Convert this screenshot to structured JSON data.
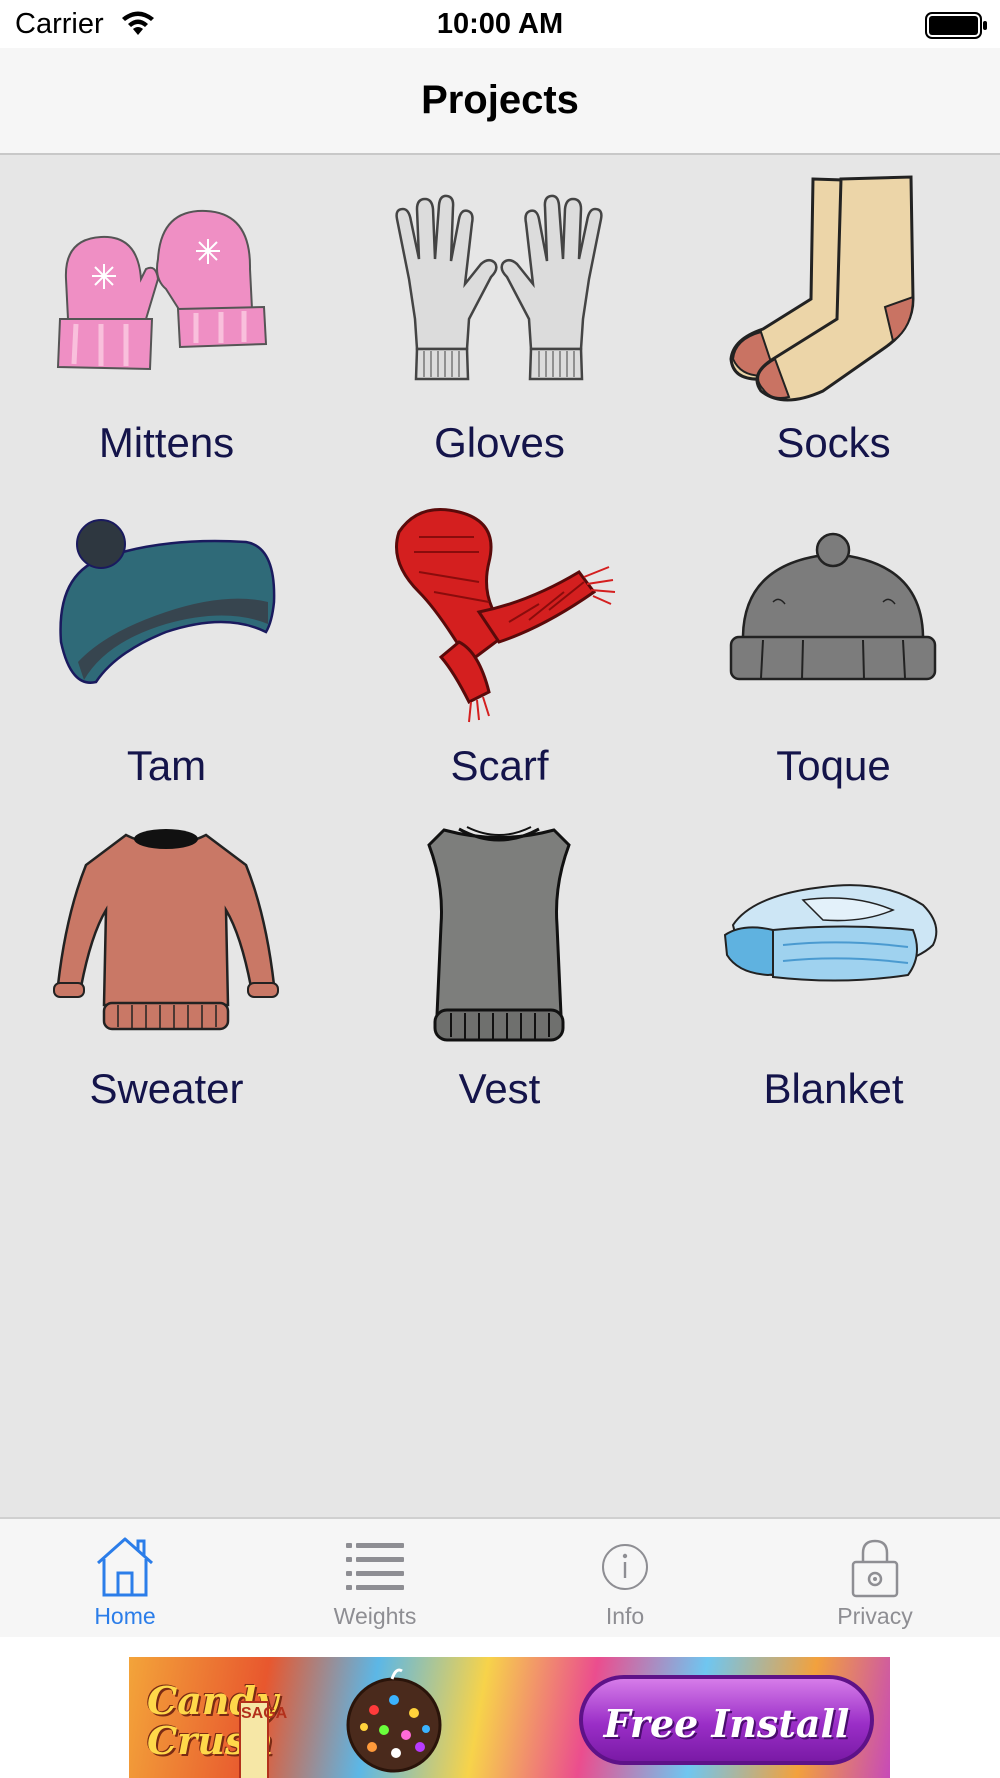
{
  "status_bar": {
    "carrier": "Carrier",
    "time": "10:00 AM"
  },
  "nav": {
    "title": "Projects"
  },
  "projects": [
    {
      "label": "Mittens",
      "icon": "mittens-icon"
    },
    {
      "label": "Gloves",
      "icon": "gloves-icon"
    },
    {
      "label": "Socks",
      "icon": "socks-icon"
    },
    {
      "label": "Tam",
      "icon": "tam-icon"
    },
    {
      "label": "Scarf",
      "icon": "scarf-icon"
    },
    {
      "label": "Toque",
      "icon": "toque-icon"
    },
    {
      "label": "Sweater",
      "icon": "sweater-icon"
    },
    {
      "label": "Vest",
      "icon": "vest-icon"
    },
    {
      "label": "Blanket",
      "icon": "blanket-icon"
    }
  ],
  "tabs": [
    {
      "label": "Home",
      "icon": "home-icon",
      "active": true
    },
    {
      "label": "Weights",
      "icon": "list-icon",
      "active": false
    },
    {
      "label": "Info",
      "icon": "info-icon",
      "active": false
    },
    {
      "label": "Privacy",
      "icon": "lock-icon",
      "active": false
    }
  ],
  "ad": {
    "logo_text": "Candy Crush",
    "saga": "SAGA",
    "button_label": "Free Install"
  },
  "colors": {
    "label_text": "#14144a",
    "tab_active": "#2b7de9",
    "tab_inactive": "#8e8e93",
    "background": "#e6e6e6"
  }
}
